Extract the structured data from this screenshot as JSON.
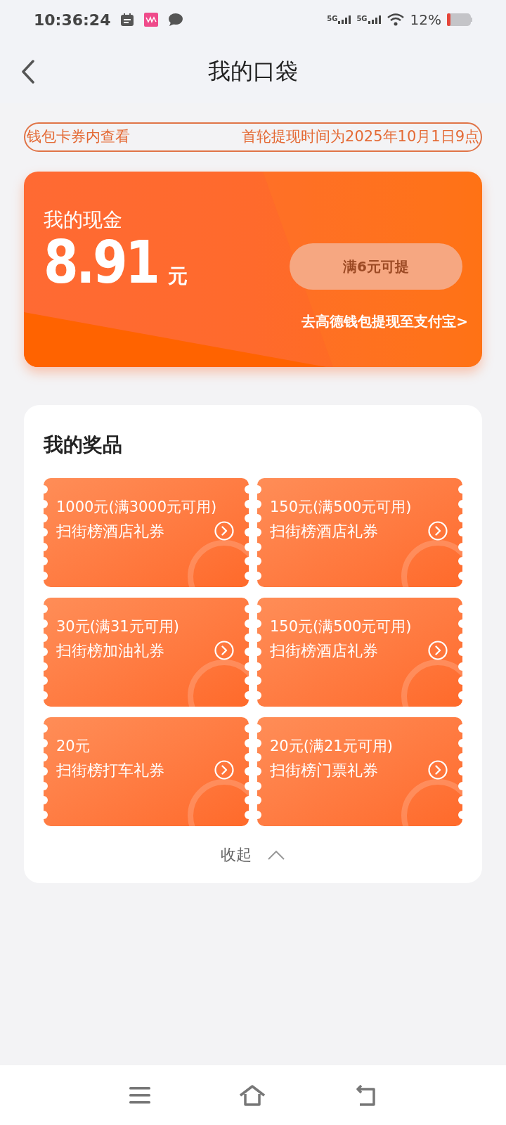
{
  "status_bar": {
    "time": "10:36:24",
    "network_1": "5G",
    "network_2": "5G",
    "battery": "12%"
  },
  "header": {
    "title": "我的口袋"
  },
  "notice": [
    "钱包卡券内查看",
    "首轮提现时间为2025年10月1日9点"
  ],
  "cash": {
    "label": "我的现金",
    "amount": "8.91",
    "unit": "元",
    "withdraw_button": {
      "label": "满6元可提",
      "disabled": true
    },
    "link": "去高德钱包提现至支付宝>"
  },
  "prizes": {
    "title": "我的奖品",
    "items": [
      {
        "value": "1000元(满3000元可用)",
        "name": "扫街榜酒店礼券"
      },
      {
        "value": "150元(满500元可用)",
        "name": "扫街榜酒店礼券"
      },
      {
        "value": "30元(满31元可用)",
        "name": "扫街榜加油礼券"
      },
      {
        "value": "150元(满500元可用)",
        "name": "扫街榜酒店礼券"
      },
      {
        "value": "20元",
        "name": "扫街榜打车礼券"
      },
      {
        "value": "20元(满21元可用)",
        "name": "扫街榜门票礼券"
      }
    ],
    "collapse": {
      "label": "收起",
      "expanded": true
    }
  }
}
